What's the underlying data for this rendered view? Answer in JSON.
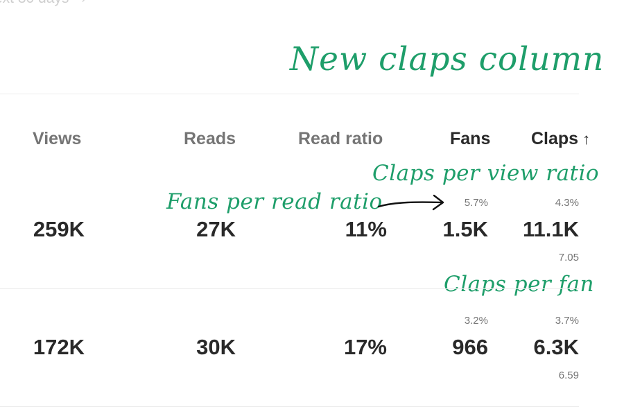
{
  "nav": {
    "next_label": "ext 30 days",
    "chevron": "›"
  },
  "annotations": {
    "title": "New claps column",
    "claps_per_view": "Claps per view ratio",
    "fans_per_read": "Fans per read ratio",
    "claps_per_fan": "Claps per fan"
  },
  "columns": {
    "views": "Views",
    "reads": "Reads",
    "read_ratio": "Read ratio",
    "fans": "Fans",
    "claps": "Claps",
    "sort_icon": "↑"
  },
  "rows": [
    {
      "views": "259K",
      "reads": "27K",
      "read_ratio": "11%",
      "fans": "1.5K",
      "fans_ratio": "5.7%",
      "claps": "11.1K",
      "claps_ratio": "4.3%",
      "claps_per_fan": "7.05"
    },
    {
      "views": "172K",
      "reads": "30K",
      "read_ratio": "17%",
      "fans": "966",
      "fans_ratio": "3.2%",
      "claps": "6.3K",
      "claps_ratio": "3.7%",
      "claps_per_fan": "6.59"
    }
  ],
  "colors": {
    "annotation": "#1e9e6a",
    "text": "#292929",
    "muted": "#757575"
  },
  "icons": {
    "arrow": "arrow-right-icon",
    "sort": "arrow-up-icon"
  }
}
